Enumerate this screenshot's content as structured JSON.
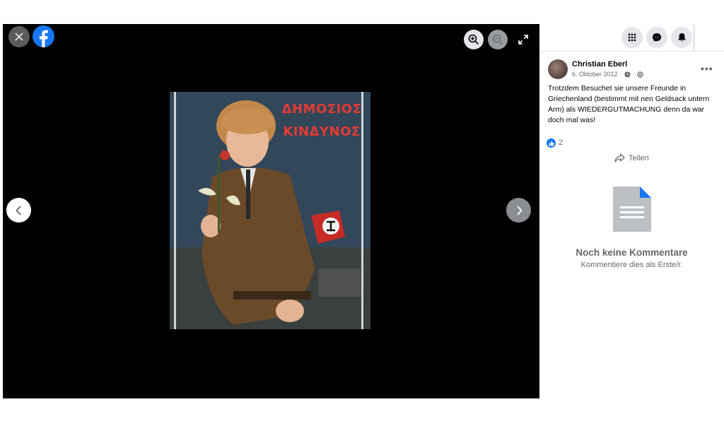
{
  "viewer": {
    "close_icon": "close-icon",
    "logo_icon": "facebook-logo",
    "zoom_in_icon": "zoom-in-icon",
    "zoom_out_icon": "zoom-out-icon",
    "fullscreen_icon": "fullscreen-icon",
    "prev_icon": "chevron-left-icon",
    "next_icon": "chevron-right-icon",
    "photo": {
      "poster_line1": "ΔΗΜΟΣΙΟΣ",
      "poster_line2": "ΚΙΝΔΥΝΟΣ"
    }
  },
  "topbar": {
    "icons": [
      "menu-grid-icon",
      "messenger-icon",
      "notifications-bell-icon"
    ]
  },
  "post": {
    "author": "Christian Eberl",
    "date": "6. Oktober 2012",
    "text": "Trotzdem Besuchet sie unsere Freunde in Griechenland (bestimmt mit nen Geldsack untern Arm) als WIEDERGUTMACHUNG denn da war doch mal was!",
    "likes": "2",
    "share_label": "Teilen",
    "more_label": "•••"
  },
  "comments": {
    "empty_title": "Noch keine Kommentare",
    "empty_subtitle": "Kommentiere dies als Erste/r."
  },
  "colors": {
    "brand": "#1877f2",
    "viewer_bg": "#000000",
    "poster_red": "#e23b35"
  }
}
